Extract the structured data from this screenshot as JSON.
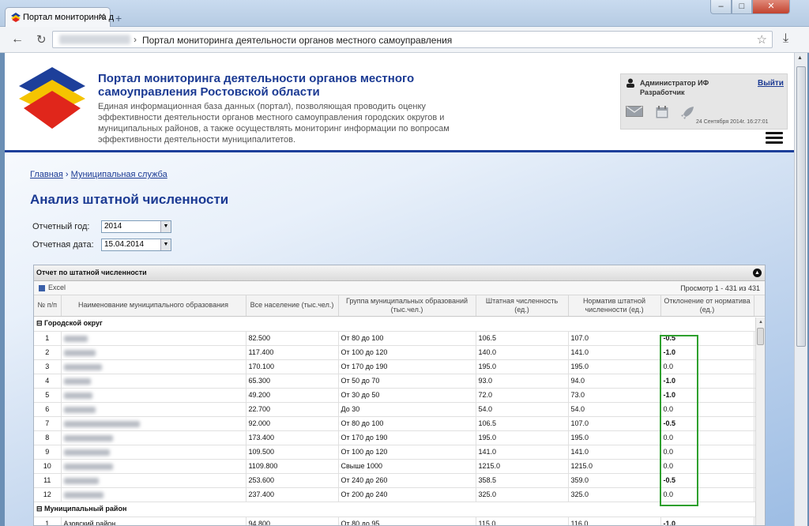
{
  "browser": {
    "tab_title": "Портал мониторинга д",
    "new_tab": "+",
    "minimize": "–",
    "maximize": "□",
    "close": "✕",
    "address": "Портал мониторинга деятельности органов местного самоуправления",
    "address_separator": "›"
  },
  "header": {
    "title": "Портал мониторинга деятельности органов местного самоуправления Ростовской области",
    "description": "Единая информационная база данных (портал), позволяющая проводить оценку эффективности деятельности органов местного самоуправления городских округов и муниципальных районов, а также осуществлять мониторинг информации по вопросам эффективности деятельности муниципалитетов."
  },
  "user": {
    "name": "Администратор ИФ",
    "role": "Разработчик",
    "logout": "Выйти",
    "datetime": "24 Сентября 2014г. 16:27:01"
  },
  "breadcrumb": {
    "home": "Главная",
    "separator": " › ",
    "section": "Муниципальная служба"
  },
  "page_title": "Анализ штатной численности",
  "filters": {
    "year_label": "Отчетный год:",
    "year_value": "2014",
    "date_label": "Отчетная дата:",
    "date_value": "15.04.2014"
  },
  "grid": {
    "caption": "Отчет по штатной численности",
    "excel": "Excel",
    "view_info": "Просмотр 1 - 431 из 431",
    "columns": [
      "№ п/п",
      "Наименование муниципального образования",
      "Все население (тыс.чел.)",
      "Группа муниципальных образований (тыс.чел.)",
      "Штатная численность (ед.)",
      "Норматив штатной численности (ед.)",
      "Отклонение от норматива (ед.)"
    ],
    "group_city": "⊟ Городской округ",
    "group_district": "⊟ Муниципальный район",
    "rows": [
      {
        "n": "1",
        "pop": "82.500",
        "grp": "От 80 до 100",
        "staff": "106.5",
        "norm": "107.0",
        "dev": "-0.5"
      },
      {
        "n": "2",
        "pop": "117.400",
        "grp": "От 100 до 120",
        "staff": "140.0",
        "norm": "141.0",
        "dev": "-1.0"
      },
      {
        "n": "3",
        "pop": "170.100",
        "grp": "От 170 до 190",
        "staff": "195.0",
        "norm": "195.0",
        "dev": "0.0"
      },
      {
        "n": "4",
        "pop": "65.300",
        "grp": "От 50 до 70",
        "staff": "93.0",
        "norm": "94.0",
        "dev": "-1.0"
      },
      {
        "n": "5",
        "pop": "49.200",
        "grp": "От 30 до 50",
        "staff": "72.0",
        "norm": "73.0",
        "dev": "-1.0"
      },
      {
        "n": "6",
        "pop": "22.700",
        "grp": "До 30",
        "staff": "54.0",
        "norm": "54.0",
        "dev": "0.0"
      },
      {
        "n": "7",
        "pop": "92.000",
        "grp": "От 80 до 100",
        "staff": "106.5",
        "norm": "107.0",
        "dev": "-0.5"
      },
      {
        "n": "8",
        "pop": "173.400",
        "grp": "От 170 до 190",
        "staff": "195.0",
        "norm": "195.0",
        "dev": "0.0"
      },
      {
        "n": "9",
        "pop": "109.500",
        "grp": "От 100 до 120",
        "staff": "141.0",
        "norm": "141.0",
        "dev": "0.0"
      },
      {
        "n": "10",
        "pop": "1109.800",
        "grp": "Свыше 1000",
        "staff": "1215.0",
        "norm": "1215.0",
        "dev": "0.0"
      },
      {
        "n": "11",
        "pop": "253.600",
        "grp": "От 240 до 260",
        "staff": "358.5",
        "norm": "359.0",
        "dev": "-0.5"
      },
      {
        "n": "12",
        "pop": "237.400",
        "grp": "От 200 до 240",
        "staff": "325.0",
        "norm": "325.0",
        "dev": "0.0"
      }
    ],
    "district_row": {
      "n": "1",
      "name": "Азовский район",
      "pop": "94.800",
      "grp": "От 80 до 95",
      "staff": "115.0",
      "norm": "116.0",
      "dev": "-1.0"
    }
  },
  "colors": {
    "brand_blue": "#1b3a93",
    "highlight_green": "#2ea02e"
  }
}
